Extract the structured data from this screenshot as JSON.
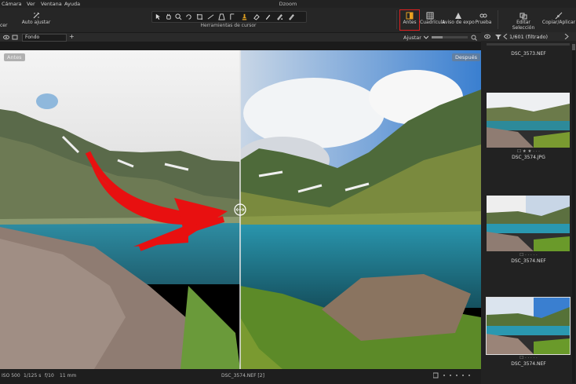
{
  "app": {
    "title": "Dzoom"
  },
  "menu": [
    "Cámara",
    "Ver",
    "Ventana",
    "Ayuda"
  ],
  "toolbar": {
    "left_cut": "cer",
    "auto_adjust": "Auto ajustar",
    "cursor_tools_label": "Herramientas de cursor",
    "antes": "Antes",
    "cuadricula": "Cuadrícula",
    "aviso": "Aviso de expo",
    "prueba": "Prueba",
    "editar": "Editar Selección",
    "copiar": "Copiar/Aplicar",
    "highlight_color": "#e02020"
  },
  "subbar": {
    "layer": "Fondo",
    "add": "+",
    "adjust": "Ajustar"
  },
  "viewer": {
    "before_label": "Antes",
    "after_label": "Después",
    "arrow_color": "#e81010"
  },
  "status": {
    "iso": "ISO 500",
    "shutter": "1/125 s",
    "aperture": "f/10",
    "focal": "11 mm",
    "filename": "DSC_3574.NEF [2]"
  },
  "browser": {
    "count": "1/601 (filtrado)",
    "items": [
      {
        "name": "DSC_3573.NEF",
        "stars": ""
      },
      {
        "name": "DSC_3574.JPG",
        "stars": "☐ ★ ★ · · ·"
      },
      {
        "name": "DSC_3574.NEF",
        "stars": "☐ · · · · ·"
      },
      {
        "name": "DSC_3574.NEF",
        "stars": "☐ · · · · ·"
      }
    ]
  }
}
